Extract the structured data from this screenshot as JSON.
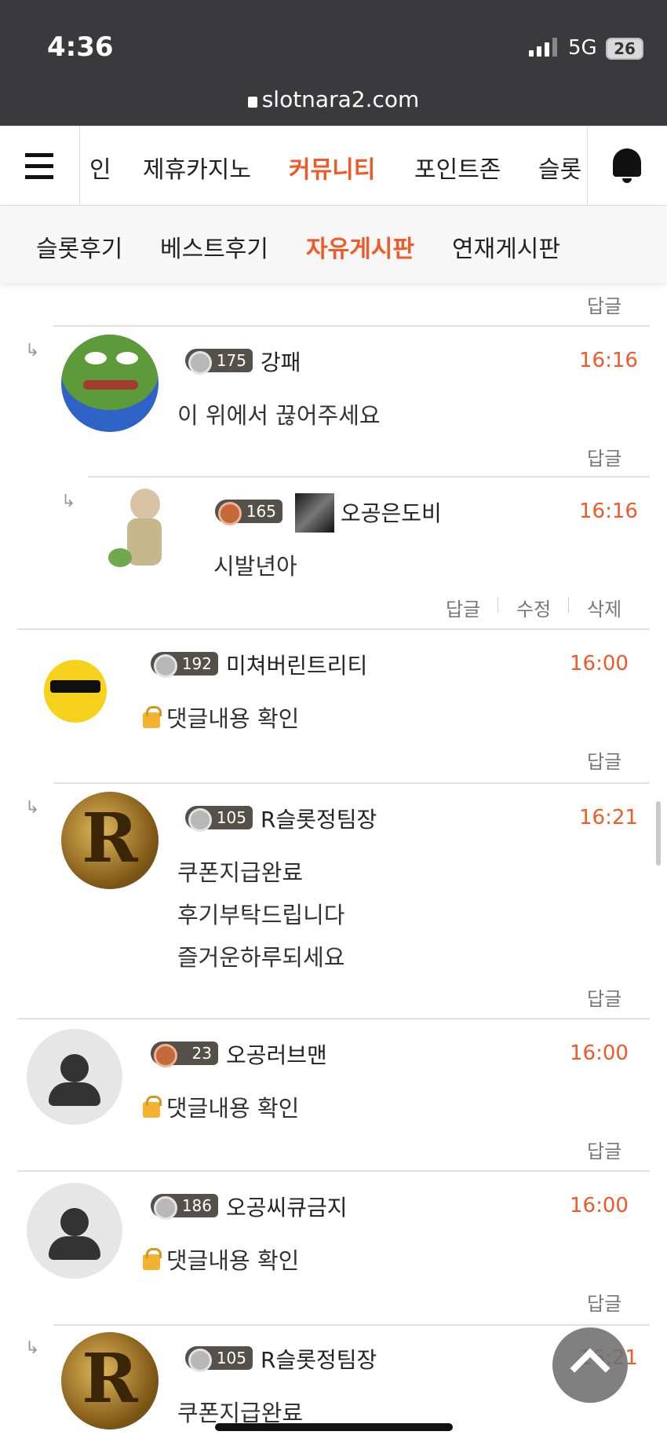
{
  "status_bar": {
    "time": "4:36",
    "network": "5G",
    "battery": "26",
    "url": "slotnara2.com"
  },
  "nav": {
    "menu_icon": "hamburger-icon",
    "items": [
      "인",
      "제휴카지노",
      "커뮤니티",
      "포인트존",
      "슬롯"
    ],
    "active": "커뮤니티",
    "bell_icon": "bell-icon"
  },
  "subnav": {
    "items": [
      "슬롯후기",
      "베스트후기",
      "자유게시판",
      "연재게시판"
    ],
    "active": "자유게시판"
  },
  "comments": [
    {
      "id": "c0",
      "reply_only": true,
      "actions": [
        "답글"
      ]
    },
    {
      "id": "c1",
      "level": "175",
      "name": "강패",
      "time": "16:16",
      "lines": [
        "이 위에서 끊어주세요"
      ],
      "actions": [
        "답글"
      ],
      "avatar": "frog-avatar"
    },
    {
      "id": "c2",
      "level": "165",
      "name": "오공은도비",
      "time": "16:16",
      "lines": [
        "시발년아"
      ],
      "actions": [
        "답글",
        "수정",
        "삭제"
      ],
      "avatar": "doll-avatar"
    },
    {
      "id": "c3",
      "level": "192",
      "name": "미쳐버린트리티",
      "time": "16:00",
      "lines": [
        "댓글내용 확인"
      ],
      "locked": true,
      "actions": [
        "답글"
      ],
      "avatar": "sunglasses-emoji-avatar"
    },
    {
      "id": "c4",
      "level": "105",
      "name": "R슬롯정팀장",
      "time": "16:21",
      "lines": [
        "쿠폰지급완료",
        "후기부탁드립니다",
        "즐거운하루되세요"
      ],
      "actions": [
        "답글"
      ],
      "avatar": "r-logo-avatar"
    },
    {
      "id": "c5",
      "level": "23",
      "name": "오공러브맨",
      "time": "16:00",
      "lines": [
        "댓글내용 확인"
      ],
      "locked": true,
      "actions": [
        "답글"
      ],
      "avatar": "default-user-avatar"
    },
    {
      "id": "c6",
      "level": "186",
      "name": "오공씨큐금지",
      "time": "16:00",
      "lines": [
        "댓글내용 확인"
      ],
      "locked": true,
      "actions": [
        "답글"
      ],
      "avatar": "default-user-avatar"
    },
    {
      "id": "c7",
      "level": "105",
      "name": "R슬롯정팀장",
      "time": "16:21",
      "lines": [
        "쿠폰지급완료"
      ],
      "actions": [],
      "avatar": "r-logo-avatar"
    }
  ],
  "scroll_top_icon": "chevron-up-icon"
}
